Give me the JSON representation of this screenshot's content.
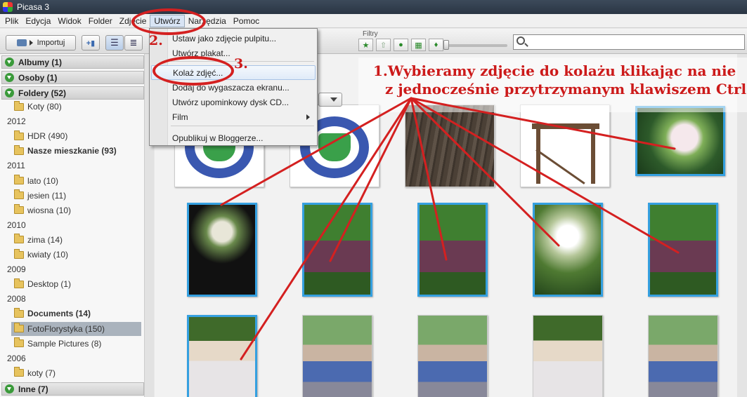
{
  "window": {
    "title": "Picasa 3"
  },
  "menubar": {
    "items": [
      "Plik",
      "Edycja",
      "Widok",
      "Folder",
      "Zdjęcie",
      "Utwórz",
      "Narzędzia",
      "Pomoc"
    ],
    "active": "Utwórz"
  },
  "toolbar": {
    "import_label": "Importuj",
    "filters_label": "Filtry",
    "filter_icons": [
      "star-icon",
      "upload-icon",
      "person-icon",
      "movie-icon",
      "pin-icon"
    ],
    "search_placeholder": ""
  },
  "sidebar": {
    "sections": [
      {
        "label": "Albumy (1)",
        "tab": "albums"
      },
      {
        "label": "Osoby (1)",
        "tab": "people"
      },
      {
        "label": "Foldery (52)",
        "tab": "folders"
      }
    ],
    "entries": [
      {
        "kind": "folder",
        "label": "Koty (80)",
        "bold": false
      },
      {
        "kind": "year",
        "label": "2012"
      },
      {
        "kind": "folder",
        "label": "HDR (490)",
        "bold": false
      },
      {
        "kind": "folder",
        "label": "Nasze mieszkanie (93)",
        "bold": true
      },
      {
        "kind": "year",
        "label": "2011"
      },
      {
        "kind": "folder",
        "label": "lato (10)",
        "bold": false
      },
      {
        "kind": "folder",
        "label": "jesien (11)",
        "bold": false
      },
      {
        "kind": "folder",
        "label": "wiosna (10)",
        "bold": false
      },
      {
        "kind": "year",
        "label": "2010"
      },
      {
        "kind": "folder",
        "label": "zima (14)",
        "bold": false
      },
      {
        "kind": "folder",
        "label": "kwiaty (10)",
        "bold": false
      },
      {
        "kind": "year",
        "label": "2009"
      },
      {
        "kind": "folder",
        "label": "Desktop (1)",
        "bold": false
      },
      {
        "kind": "year",
        "label": "2008"
      },
      {
        "kind": "folder",
        "label": "Documents (14)",
        "bold": true
      },
      {
        "kind": "folder",
        "label": "FotoFlorystyka (150)",
        "bold": false,
        "selected": true
      },
      {
        "kind": "folder",
        "label": "Sample Pictures (8)",
        "bold": false
      },
      {
        "kind": "year",
        "label": "2006"
      },
      {
        "kind": "folder",
        "label": "koty (7)",
        "bold": false
      }
    ],
    "footer_section": {
      "label": "Inne (7)"
    }
  },
  "create_menu": {
    "items": [
      {
        "label": "Ustaw jako zdjęcie pulpitu...",
        "submenu": false
      },
      {
        "label": "Utwórz plakat...",
        "submenu": false
      },
      {
        "label": "Kolaż zdjęć...",
        "submenu": false,
        "highlighted": true
      },
      {
        "label": "Dodaj do wygaszacza ekranu...",
        "submenu": false
      },
      {
        "label": "Utwórz upominkowy dysk CD...",
        "submenu": false
      },
      {
        "label": "Film",
        "submenu": true
      },
      {
        "label": "Opublikuj w Bloggerze...",
        "submenu": false
      }
    ]
  },
  "annotations": {
    "step2": "2.",
    "step3": "3.",
    "instruction_line1": "1.Wybieramy zdjęcie do kolażu klikając na nie",
    "instruction_line2": "z jednocześnie przytrzymanym klawiszem Ctrl",
    "color": "#d42020"
  },
  "thumbnails": [
    {
      "kind": "logo",
      "selected": false
    },
    {
      "kind": "logo",
      "selected": false
    },
    {
      "kind": "tree",
      "selected": false
    },
    {
      "kind": "table",
      "selected": false
    },
    {
      "kind": "flowers",
      "selected": true
    },
    {
      "kind": "dark",
      "selected": true
    },
    {
      "kind": "party",
      "selected": true
    },
    {
      "kind": "party",
      "selected": true
    },
    {
      "kind": "candles",
      "selected": true
    },
    {
      "kind": "party",
      "selected": true
    },
    {
      "kind": "portrait",
      "selected": true
    },
    {
      "kind": "people",
      "selected": false
    },
    {
      "kind": "people",
      "selected": false
    },
    {
      "kind": "portrait",
      "selected": false
    },
    {
      "kind": "people",
      "selected": false
    }
  ]
}
